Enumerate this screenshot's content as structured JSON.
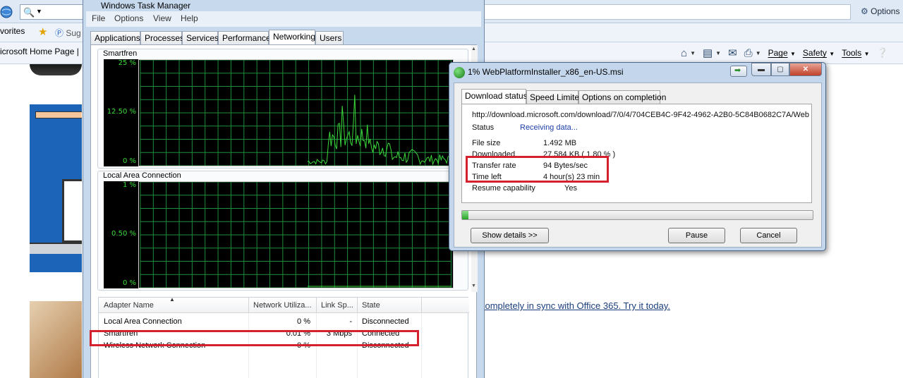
{
  "browser": {
    "options_label": "Options",
    "favorites_label": "vorites",
    "suggested_label": "Sug",
    "tab_label": "icrosoft Home Page |",
    "commands": {
      "page": "Page",
      "safety": "Safety",
      "tools": "Tools"
    },
    "page_link": "completely in sync with Office 365. Try it today."
  },
  "task_manager": {
    "title": "Windows Task Manager",
    "menu": [
      "File",
      "Options",
      "View",
      "Help"
    ],
    "tabs": [
      "Applications",
      "Processes",
      "Services",
      "Performance",
      "Networking",
      "Users"
    ],
    "active_tab": "Networking",
    "graphs": [
      {
        "name": "Smartfren",
        "y_labels": [
          "25 %",
          "12.50 %",
          "0 %"
        ]
      },
      {
        "name": "Local Area Connection",
        "y_labels": [
          "1 %",
          "0.50 %",
          "0 %"
        ]
      }
    ],
    "adapter_table": {
      "columns": [
        "Adapter Name",
        "Network Utiliza...",
        "Link Sp...",
        "State"
      ],
      "rows": [
        {
          "name": "Local Area Connection",
          "utilization": "0 %",
          "speed": "-",
          "state": "Disconnected"
        },
        {
          "name": "Smartfren",
          "utilization": "0.01 %",
          "speed": "3 Mbps",
          "state": "Connected"
        },
        {
          "name": "Wireless Network Connection",
          "utilization": "0 %",
          "speed": "-",
          "state": "Disconnected"
        }
      ]
    }
  },
  "download": {
    "title": "1% WebPlatformInstaller_x86_en-US.msi",
    "tabs": [
      "Download status",
      "Speed Limiter",
      "Options on completion"
    ],
    "active_tab": "Download status",
    "url": "http://download.microsoft.com/download/7/0/4/704CEB4C-9F42-4962-A2B0-5C84B0682C7A/Web",
    "status_label": "Status",
    "status_value": "Receiving data...",
    "file_size_label": "File size",
    "file_size_value": "1.492  MB",
    "downloaded_label": "Downloaded",
    "downloaded_value": "27.584  KB  ( 1.80 % )",
    "transfer_rate_label": "Transfer rate",
    "transfer_rate_value": "94  Bytes/sec",
    "time_left_label": "Time left",
    "time_left_value": "4 hour(s) 23 min",
    "resume_label": "Resume capability",
    "resume_value": "Yes",
    "progress_fraction": 0.018,
    "buttons": {
      "show_details": "Show details >>",
      "pause": "Pause",
      "cancel": "Cancel"
    }
  },
  "colors": {
    "highlight": "#d3222e",
    "graph_line": "#3bdc3b",
    "graph_grid": "#1f8f3a",
    "graph_bg": "#000000"
  }
}
